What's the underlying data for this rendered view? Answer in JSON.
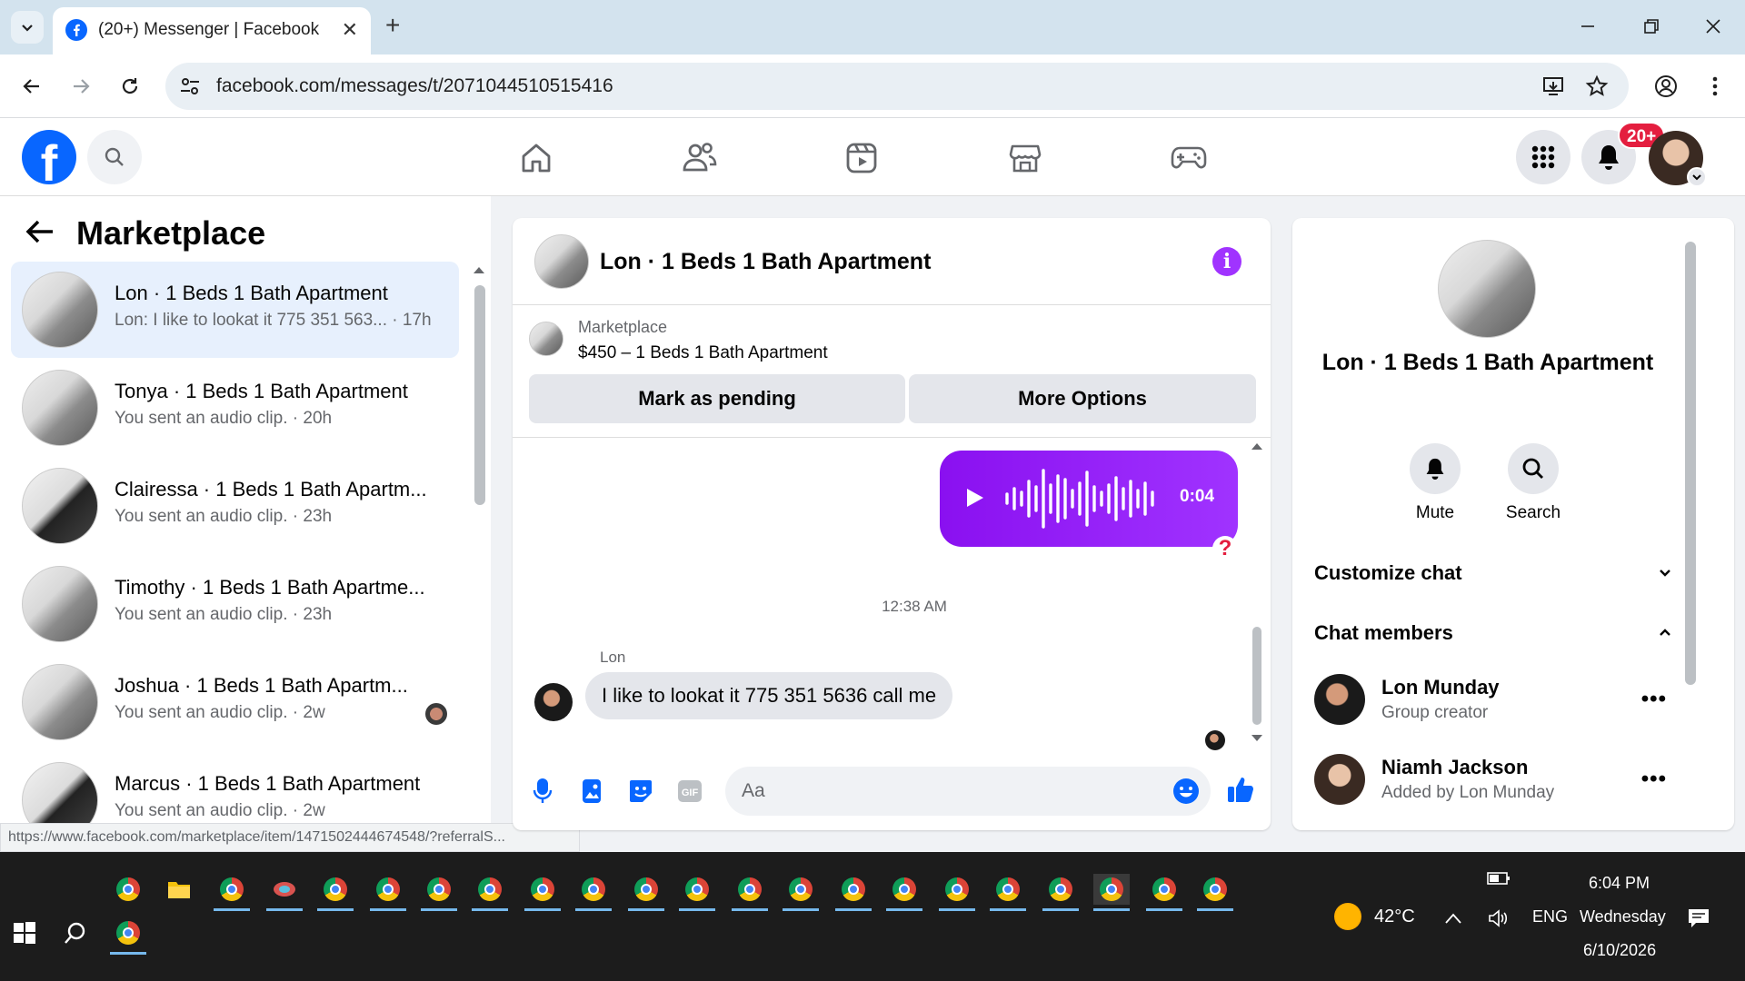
{
  "browser": {
    "tab_title": "(20+) Messenger | Facebook",
    "url": "facebook.com/messages/t/2071044510515416",
    "status_url": "https://www.facebook.com/marketplace/item/1471502444674548/?referralS..."
  },
  "fb": {
    "notifications_badge": "20+",
    "brand_color": "#0866ff"
  },
  "sidebar": {
    "title": "Marketplace",
    "conversations": [
      {
        "name": "Lon · 1 Beds 1 Bath Apartment",
        "snippet": "Lon: I like to lookat it 775 351 563... · 17h",
        "active": true
      },
      {
        "name": "Tonya · 1 Beds 1 Bath Apartment",
        "snippet": "You sent an audio clip. · 20h"
      },
      {
        "name": "Clairessa · 1 Beds 1 Bath Apartm...",
        "snippet": "You sent an audio clip. · 23h"
      },
      {
        "name": "Timothy · 1 Beds 1 Bath Apartme...",
        "snippet": "You sent an audio clip. · 23h"
      },
      {
        "name": "Joshua · 1 Beds 1 Bath Apartm...",
        "snippet": "You sent an audio clip. · 2w"
      },
      {
        "name": "Marcus · 1 Beds 1 Bath Apartment",
        "snippet": "You sent an audio clip. · 2w"
      }
    ]
  },
  "chat": {
    "title": "Lon · 1 Beds 1 Bath Apartment",
    "marketplace_label": "Marketplace",
    "listing": "$450 – 1 Beds 1 Bath Apartment",
    "mark_pending_label": "Mark as pending",
    "more_options_label": "More Options",
    "audio_duration": "0:04",
    "timestamp": "12:38 AM",
    "sender_name": "Lon",
    "incoming_message": "I like to lookat it 775 351 5636 call me",
    "composer_placeholder": "Aa",
    "accent_color": "#a033ff"
  },
  "info_panel": {
    "name": "Lon · 1 Beds 1 Bath Apartment",
    "mute_label": "Mute",
    "search_label": "Search",
    "customize_label": "Customize chat",
    "members_label": "Chat members",
    "members": [
      {
        "name": "Lon Munday",
        "role": "Group creator"
      },
      {
        "name": "Niamh Jackson",
        "role": "Added by Lon Munday"
      }
    ]
  },
  "taskbar": {
    "temperature": "42°C",
    "language": "ENG",
    "time": "6:04 PM",
    "day": "Wednesday",
    "date": "6/10/2026"
  }
}
